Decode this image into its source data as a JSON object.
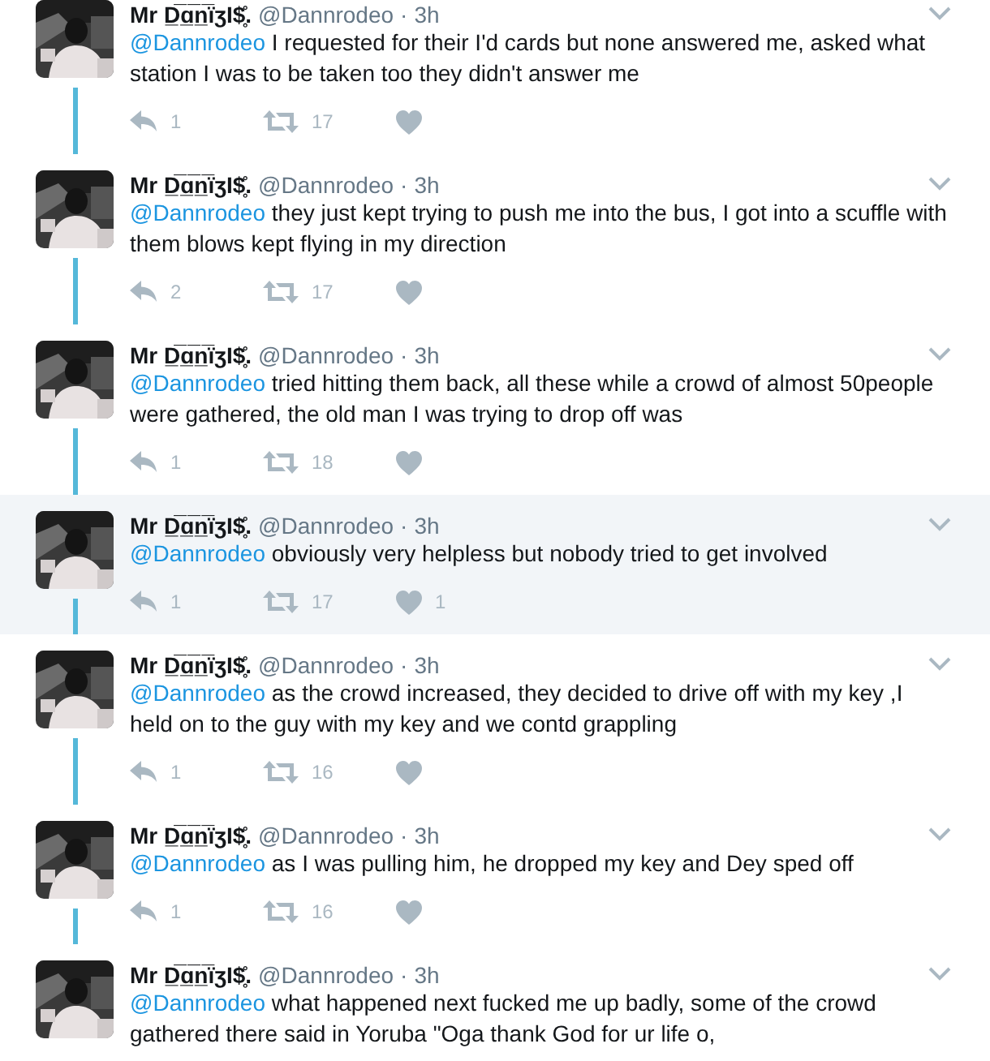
{
  "tweets": [
    {
      "name": "Mr D̲̅ɑ̲̅n̲̅ïʒI$̥̊.",
      "handle": "@Dannrodeo",
      "separator": "·",
      "time": "3h",
      "mention": "@Dannrodeo",
      "text": "I requested for their I'd cards but none answered me, asked what station I was to be taken too they didn't answer me",
      "highlighted": false,
      "actions": {
        "replies": "1",
        "retweets": "17"
      }
    },
    {
      "name": "Mr D̲̅ɑ̲̅n̲̅ïʒI$̥̊.",
      "handle": "@Dannrodeo",
      "separator": "·",
      "time": "3h",
      "mention": "@Dannrodeo",
      "text": "they just kept trying to push me into the bus, I got into a scuffle with them blows kept flying in my direction",
      "highlighted": false,
      "actions": {
        "replies": "2",
        "retweets": "17"
      }
    },
    {
      "name": "Mr D̲̅ɑ̲̅n̲̅ïʒI$̥̊.",
      "handle": "@Dannrodeo",
      "separator": "·",
      "time": "3h",
      "mention": "@Dannrodeo",
      "text": "tried hitting them back, all these while a crowd of almost 50people were gathered, the old man I was trying to drop off was",
      "highlighted": false,
      "actions": {
        "replies": "1",
        "retweets": "18"
      }
    },
    {
      "name": "Mr D̲̅ɑ̲̅n̲̅ïʒI$̥̊.",
      "handle": "@Dannrodeo",
      "separator": "·",
      "time": "3h",
      "mention": "@Dannrodeo",
      "text": "obviously very helpless but nobody tried to get involved",
      "highlighted": true,
      "actions": {
        "replies": "1",
        "retweets": "17",
        "likes": "1"
      }
    },
    {
      "name": "Mr D̲̅ɑ̲̅n̲̅ïʒI$̥̊.",
      "handle": "@Dannrodeo",
      "separator": "·",
      "time": "3h",
      "mention": "@Dannrodeo",
      "text": "as the crowd increased, they decided to drive off with my key ,I held on to the guy with my key and we contd grappling",
      "highlighted": false,
      "actions": {
        "replies": "1",
        "retweets": "16"
      }
    },
    {
      "name": "Mr D̲̅ɑ̲̅n̲̅ïʒI$̥̊.",
      "handle": "@Dannrodeo",
      "separator": "·",
      "time": "3h",
      "mention": "@Dannrodeo",
      "text": "as I was pulling him, he dropped my key and Dey sped off",
      "highlighted": false,
      "actions": {
        "replies": "1",
        "retweets": "16"
      }
    },
    {
      "name": "Mr D̲̅ɑ̲̅n̲̅ïʒI$̥̊.",
      "handle": "@Dannrodeo",
      "separator": "·",
      "time": "3h",
      "mention": "@Dannrodeo",
      "text": "what happened next fucked me up badly, some of the crowd gathered there said in Yoruba \"Oga thank God for ur life o,",
      "highlighted": false
    }
  ]
}
